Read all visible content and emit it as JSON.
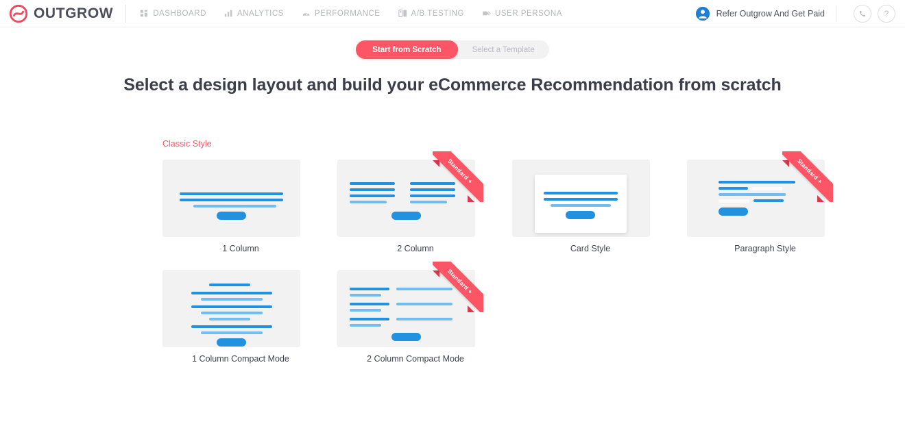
{
  "nav": {
    "brand": "OUTGROW",
    "brand_icon": "outgrow-logo-icon",
    "items": [
      {
        "label": "DASHBOARD",
        "icon": "grid-icon"
      },
      {
        "label": "ANALYTICS",
        "icon": "bar-chart-icon"
      },
      {
        "label": "PERFORMANCE",
        "icon": "speedometer-icon"
      },
      {
        "label": "A/B TESTING",
        "icon": "ab-test-icon"
      },
      {
        "label": "USER PERSONA",
        "icon": "tag-icon"
      }
    ],
    "refer": {
      "label": "Refer Outgrow And Get Paid",
      "icon": "user-avatar-icon"
    },
    "phone_button": {
      "icon": "phone-icon",
      "label": "✆"
    },
    "help_button": {
      "icon": "question-mark-icon",
      "label": "?"
    }
  },
  "toggle": {
    "active": "Start from Scratch",
    "inactive": "Select a Template",
    "active_color": "#fc5566"
  },
  "page_title": "Select a design layout and build your eCommerce Recommendation from scratch",
  "section": {
    "label": "Classic Style",
    "label_color": "#fc5566",
    "ribbon_text": "Standard +",
    "layouts": [
      {
        "name": "1 Column",
        "preview": "one-column",
        "ribbon": false
      },
      {
        "name": "2 Column",
        "preview": "two-column",
        "ribbon": true
      },
      {
        "name": "Card Style",
        "preview": "card-style",
        "ribbon": false
      },
      {
        "name": "Paragraph Style",
        "preview": "paragraph-style",
        "ribbon": true
      },
      {
        "name": "1 Column Compact Mode",
        "preview": "one-column-compact",
        "ribbon": false
      },
      {
        "name": "2 Column Compact Mode",
        "preview": "two-column-compact",
        "ribbon": true
      }
    ]
  },
  "colors": {
    "accent_blue": "#2291e0",
    "light_blue": "#72bdf0",
    "thumb_bg": "#f2f2f2",
    "accent_red": "#fc5566"
  }
}
